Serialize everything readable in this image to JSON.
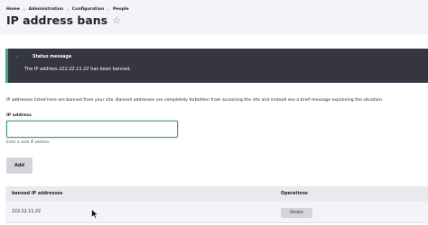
{
  "breadcrumb": {
    "items": [
      "Home",
      "Administration",
      "Configuration",
      "People"
    ],
    "separator": "›"
  },
  "page": {
    "title": "IP address bans",
    "favorite_icon": "star-outline-icon"
  },
  "status": {
    "heading": "Status message",
    "text_prefix": "The IP address ",
    "ip": "222.22.11.22",
    "text_suffix": " has been banned.",
    "icon": "check-icon",
    "accent": "#42a877"
  },
  "intro": "IP addresses listed here are banned from your site. Banned addresses are completely forbidden from accessing the site and instead see a brief message explaining the situation.",
  "form": {
    "label": "IP address",
    "value": "",
    "placeholder": "",
    "description": "Enter a valid IP address.",
    "submit_label": "Add"
  },
  "table": {
    "columns": [
      "banned IP addresses",
      "Operations"
    ],
    "rows": [
      {
        "ip": "222.22.11.22",
        "action": "Delete"
      }
    ]
  },
  "colors": {
    "status_background": "#353641",
    "input_border": "#3b9e6b",
    "button_background": "#d3d4d9"
  }
}
